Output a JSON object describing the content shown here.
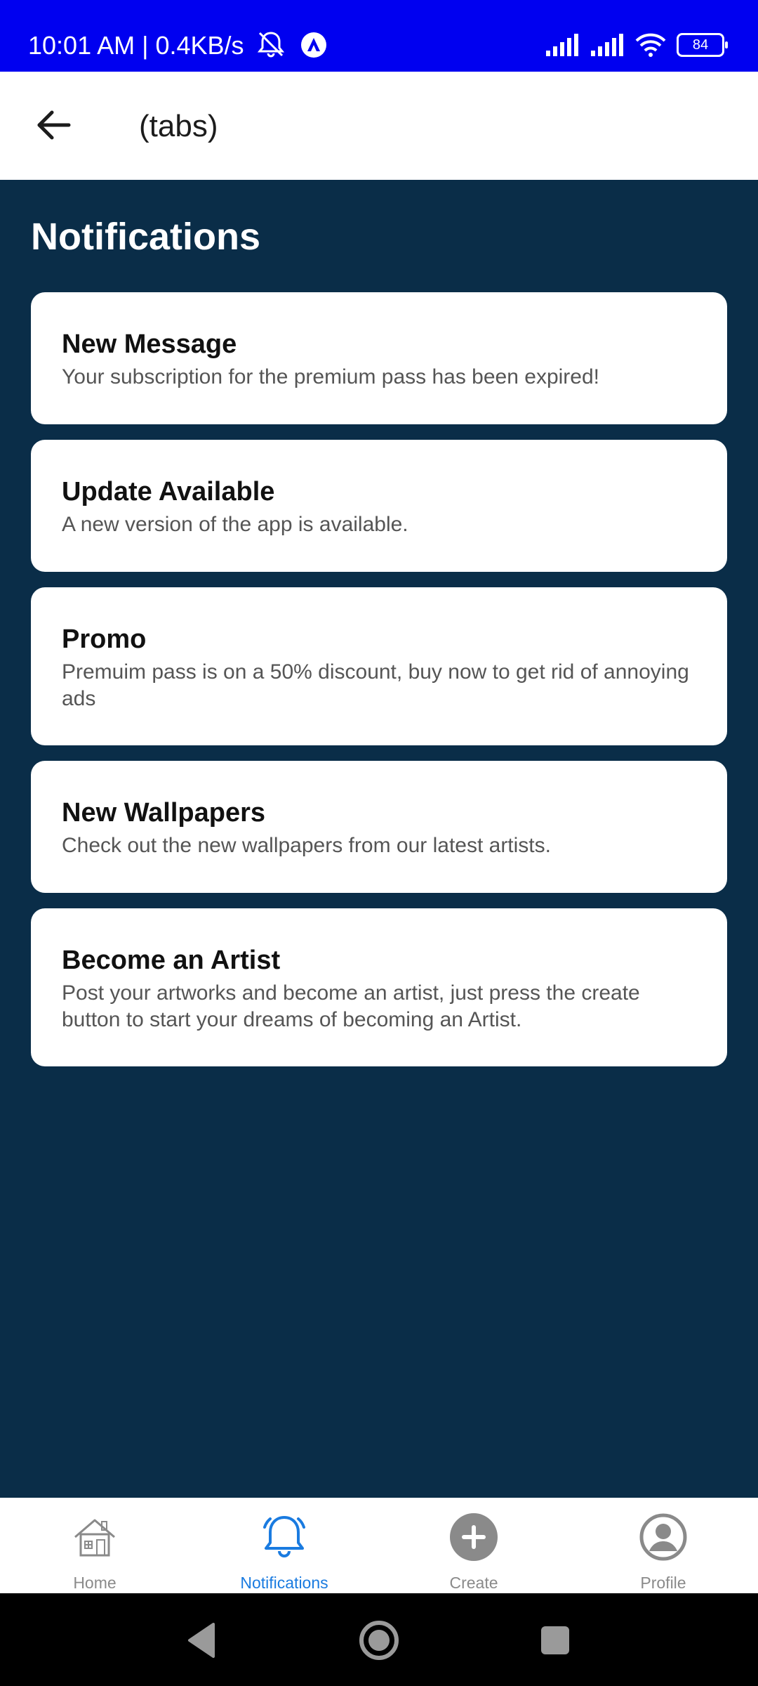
{
  "status_bar": {
    "time_text": "10:01 AM | 0.4KB/s",
    "battery": "84",
    "icons": [
      "mute-bell-icon",
      "app-badge-icon",
      "signal-icon",
      "signal-icon",
      "wifi-icon",
      "battery-icon"
    ]
  },
  "header": {
    "back_icon": "arrow-left-icon",
    "title": "(tabs)"
  },
  "page": {
    "title": "Notifications"
  },
  "notifications": [
    {
      "title": "New Message",
      "body": "Your subscription for the premium pass has been expired!"
    },
    {
      "title": "Update Available",
      "body": "A new version of the app is available."
    },
    {
      "title": "Promo",
      "body": "Premuim pass is on a 50% discount, buy now to get rid of annoying ads"
    },
    {
      "title": "New Wallpapers",
      "body": "Check out the new wallpapers from our latest artists."
    },
    {
      "title": "Become an Artist",
      "body": "Post your artworks and become an artist, just press the create button to start your dreams of becoming an Artist."
    }
  ],
  "bottom_nav": {
    "items": [
      {
        "label": "Home",
        "icon": "home-icon",
        "active": false
      },
      {
        "label": "Notifications",
        "icon": "bell-icon",
        "active": true
      },
      {
        "label": "Create",
        "icon": "plus-circle-icon",
        "active": false
      },
      {
        "label": "Profile",
        "icon": "profile-icon",
        "active": false
      }
    ]
  },
  "colors": {
    "status_bar": "#0000f0",
    "background": "#0a2d48",
    "card": "#ffffff",
    "accent": "#1a7be0",
    "inactive": "#8a8a8a"
  }
}
